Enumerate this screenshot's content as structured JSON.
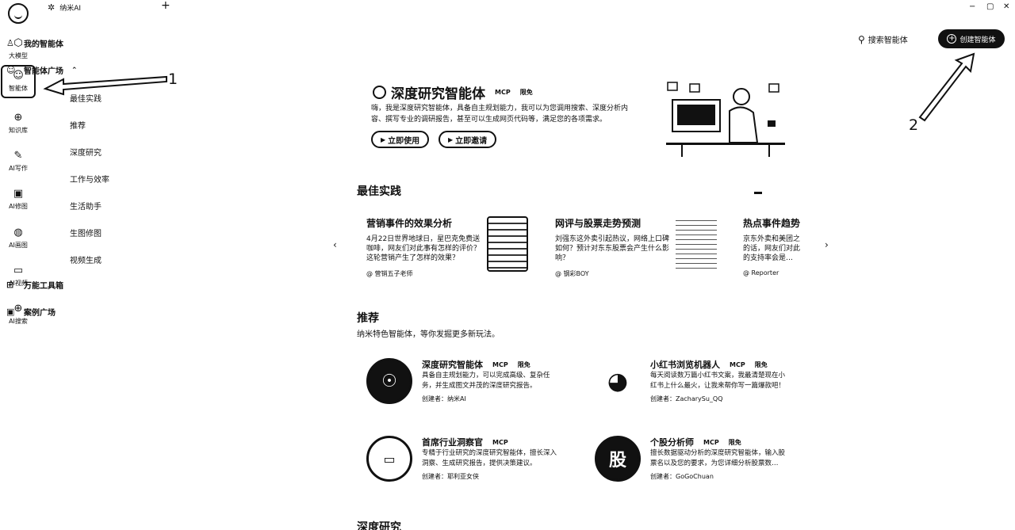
{
  "app": {
    "title": "纳米AI",
    "new_tab": "+"
  },
  "window": {
    "minimize": "−",
    "maximize": "▢",
    "close": "✕"
  },
  "rail": [
    {
      "label": "大模型",
      "icon": "cube-icon"
    },
    {
      "label": "智能体",
      "icon": "agent-icon",
      "active": true
    },
    {
      "label": "知识库",
      "icon": "bulb-icon"
    },
    {
      "label": "AI写作",
      "icon": "pen-icon"
    },
    {
      "label": "AI修图",
      "icon": "image-edit-icon"
    },
    {
      "label": "AI画图",
      "icon": "palette-icon"
    },
    {
      "label": "AI视频",
      "icon": "video-icon"
    },
    {
      "label": "AI搜索",
      "icon": "globe-icon"
    }
  ],
  "sidebar": {
    "my_agents": "我的智能体",
    "agent_plaza": "智能体广场",
    "sub": [
      "最佳实践",
      "推荐",
      "深度研究",
      "工作与效率",
      "生活助手",
      "生图修图",
      "视频生成"
    ],
    "toolbox": "万能工具箱",
    "case_plaza": "案例广场"
  },
  "annotations": {
    "one": "1",
    "two": "2"
  },
  "header": {
    "search": "搜索智能体",
    "create": "创建智能体"
  },
  "hero": {
    "title": "深度研究智能体",
    "tag_mcp": "MCP",
    "tag_free": "限免",
    "desc": "嗨，我是深度研究智能体，具备自主规划能力，我可以为您调用搜索、深度分析内容、撰写专业的调研报告，甚至可以生成网页代码等，满足您的各项需求。",
    "btn_use": "立即使用",
    "btn_invite": "立即邀请"
  },
  "best": {
    "title": "最佳实践",
    "cards": [
      {
        "title": "营销事件的效果分析",
        "desc": "4月22日世界地球日，星巴克免费送咖啡，网友们对此事有怎样的评价？这轮营销产生了怎样的效果？",
        "author": "@ 营销五子老师"
      },
      {
        "title": "网评与股票走势预测",
        "desc": "刘强东这外卖引起热议，网络上口碑如何？预计对东东股票会产生什么影响？",
        "author": "@ 钢彩BOY"
      },
      {
        "title": "热点事件趋势",
        "desc": "京东外卖和美团之的话，网友们对此的支持率会是…",
        "author": "@ Reporter"
      }
    ],
    "prev": "‹",
    "next": "›"
  },
  "recommend": {
    "title": "推荐",
    "subtitle": "纳米特色智能体，等你发掘更多新玩法。",
    "cards": [
      {
        "name": "深度研究智能体",
        "tags": [
          "MCP",
          "限免"
        ],
        "desc": "具备自主规划能力，可以完成高级、复杂任务，并生成图文并茂的深度研究报告。",
        "author": "创建者：纳米AI"
      },
      {
        "name": "小红书浏览机器人",
        "tags": [
          "MCP",
          "限免"
        ],
        "desc": "每天阅读数万篇小红书文案，我最清楚现在小红书上什么最火，让我来帮你写一篇爆款吧！",
        "author": "创建者：ZacharySu_QQ"
      },
      {
        "name": "首席行业洞察官",
        "tags": [
          "MCP"
        ],
        "desc": "专精于行业研究的深度研究智能体，擅长深入洞察、生成研究报告，提供决策建议。",
        "author": "创建者：耶利亚女侠"
      },
      {
        "name": "个股分析师",
        "tags": [
          "MCP",
          "限免"
        ],
        "desc": "擅长数据驱动分析的深度研究智能体，输入股票名以及您的要求，为您详细分析股票数…",
        "author": "创建者：GoGoChuan",
        "avatar_char": "股"
      }
    ]
  },
  "deep": {
    "title": "深度研究"
  }
}
